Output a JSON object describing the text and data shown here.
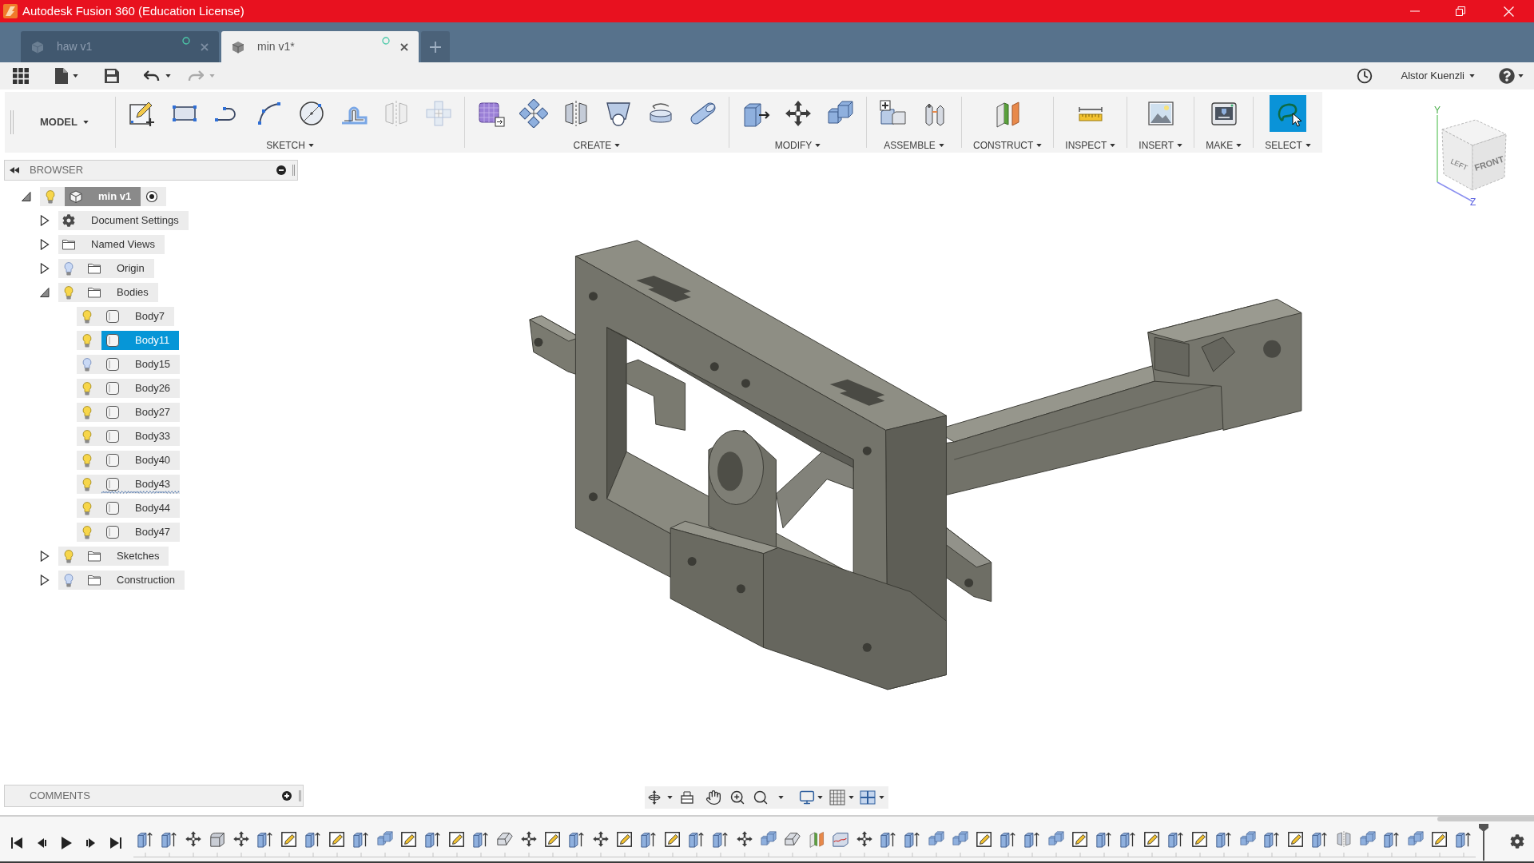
{
  "window": {
    "title": "Autodesk Fusion 360 (Education License)"
  },
  "tabs": [
    {
      "label": "haw v1",
      "selected": false
    },
    {
      "label": "min v1*",
      "selected": true
    }
  ],
  "quick_access": {
    "undo": {
      "disabled": false
    },
    "redo": {
      "disabled": true
    },
    "user": "Alstor Kuenzli"
  },
  "toolbar": {
    "workspace": "MODEL",
    "groups": [
      {
        "label": "SKETCH",
        "tools": [
          {
            "kind": "sketch",
            "selected": false,
            "disabled": false
          },
          {
            "kind": "rectangle",
            "selected": false,
            "disabled": false
          },
          {
            "kind": "line",
            "selected": false,
            "disabled": false
          },
          {
            "kind": "arc",
            "selected": false,
            "disabled": false
          },
          {
            "kind": "circle",
            "selected": false,
            "disabled": false
          },
          {
            "kind": "offset",
            "selected": false,
            "disabled": false
          },
          {
            "kind": "sketchmirror",
            "selected": false,
            "disabled": true
          },
          {
            "kind": "sketchpattern",
            "selected": false,
            "disabled": true
          }
        ]
      },
      {
        "label": "CREATE",
        "tools": [
          {
            "kind": "form",
            "selected": false,
            "disabled": false
          },
          {
            "kind": "pattern",
            "selected": false,
            "disabled": false
          },
          {
            "kind": "mirror",
            "selected": false,
            "disabled": false
          },
          {
            "kind": "hole",
            "selected": false,
            "disabled": false
          },
          {
            "kind": "revolve",
            "selected": false,
            "disabled": false
          },
          {
            "kind": "pipe",
            "selected": false,
            "disabled": false
          }
        ]
      },
      {
        "label": "MODIFY",
        "tools": [
          {
            "kind": "presspull",
            "selected": false,
            "disabled": false
          },
          {
            "kind": "move",
            "selected": false,
            "disabled": false
          },
          {
            "kind": "combine",
            "selected": false,
            "disabled": false
          }
        ]
      },
      {
        "label": "ASSEMBLE",
        "tools": [
          {
            "kind": "newcomponent",
            "selected": false,
            "disabled": false
          },
          {
            "kind": "joint",
            "selected": false,
            "disabled": false
          }
        ]
      },
      {
        "label": "CONSTRUCT",
        "tools": [
          {
            "kind": "plane",
            "selected": false,
            "disabled": false
          }
        ]
      },
      {
        "label": "INSPECT",
        "tools": [
          {
            "kind": "measure",
            "selected": false,
            "disabled": false
          }
        ]
      },
      {
        "label": "INSERT",
        "tools": [
          {
            "kind": "image",
            "selected": false,
            "disabled": false
          }
        ]
      },
      {
        "label": "MAKE",
        "tools": [
          {
            "kind": "print",
            "selected": false,
            "disabled": false
          }
        ]
      },
      {
        "label": "SELECT",
        "tools": [
          {
            "kind": "select",
            "selected": true,
            "disabled": false
          }
        ]
      }
    ]
  },
  "browser": {
    "title": "BROWSER",
    "tree": [
      {
        "label": "min v1",
        "kind": "component",
        "visible": true,
        "active": true,
        "expanded": true,
        "selected": false,
        "children": [
          {
            "label": "Document Settings",
            "kind": "settings",
            "expanded": false,
            "selected": false
          },
          {
            "label": "Named Views",
            "kind": "folder",
            "expanded": false,
            "selected": false
          },
          {
            "label": "Origin",
            "kind": "folder",
            "visible": false,
            "expanded": false,
            "selected": false
          },
          {
            "label": "Bodies",
            "kind": "folder",
            "visible": true,
            "expanded": true,
            "selected": false,
            "children": [
              {
                "label": "Body7",
                "kind": "body",
                "visible": true,
                "selected": false,
                "wavy_underline": false
              },
              {
                "label": "Body11",
                "kind": "body",
                "visible": true,
                "selected": true,
                "wavy_underline": false
              },
              {
                "label": "Body15",
                "kind": "body",
                "visible": false,
                "selected": false,
                "wavy_underline": false
              },
              {
                "label": "Body26",
                "kind": "body",
                "visible": true,
                "selected": false,
                "wavy_underline": false
              },
              {
                "label": "Body27",
                "kind": "body",
                "visible": true,
                "selected": false,
                "wavy_underline": false
              },
              {
                "label": "Body33",
                "kind": "body",
                "visible": true,
                "selected": false,
                "wavy_underline": false
              },
              {
                "label": "Body40",
                "kind": "body",
                "visible": true,
                "selected": false,
                "wavy_underline": false
              },
              {
                "label": "Body43",
                "kind": "body",
                "visible": true,
                "selected": false,
                "wavy_underline": true
              },
              {
                "label": "Body44",
                "kind": "body",
                "visible": true,
                "selected": false,
                "wavy_underline": false
              },
              {
                "label": "Body47",
                "kind": "body",
                "visible": true,
                "selected": false,
                "wavy_underline": false
              }
            ]
          },
          {
            "label": "Sketches",
            "kind": "folder",
            "visible": true,
            "expanded": false,
            "selected": false
          },
          {
            "label": "Construction",
            "kind": "folder",
            "visible": false,
            "expanded": false,
            "selected": false
          }
        ]
      }
    ]
  },
  "viewcube": {
    "left": "LEFT",
    "front": "FRONT",
    "axis_y": "Y",
    "axis_z": "Z"
  },
  "comments": {
    "title": "COMMENTS"
  },
  "timeline": {
    "features": [
      {
        "kind": "extrude"
      },
      {
        "kind": "extrude"
      },
      {
        "kind": "move"
      },
      {
        "kind": "fillet"
      },
      {
        "kind": "move"
      },
      {
        "kind": "extrude"
      },
      {
        "kind": "sketch"
      },
      {
        "kind": "extrude"
      },
      {
        "kind": "sketch"
      },
      {
        "kind": "extrude"
      },
      {
        "kind": "combine"
      },
      {
        "kind": "sketch"
      },
      {
        "kind": "extrude"
      },
      {
        "kind": "sketch"
      },
      {
        "kind": "extrude"
      },
      {
        "kind": "chamfer"
      },
      {
        "kind": "move"
      },
      {
        "kind": "sketch"
      },
      {
        "kind": "extrude"
      },
      {
        "kind": "move"
      },
      {
        "kind": "sketch"
      },
      {
        "kind": "extrude"
      },
      {
        "kind": "sketch"
      },
      {
        "kind": "extrude"
      },
      {
        "kind": "extrude"
      },
      {
        "kind": "move"
      },
      {
        "kind": "combine"
      },
      {
        "kind": "chamfer"
      },
      {
        "kind": "plane"
      },
      {
        "kind": "split"
      },
      {
        "kind": "move"
      },
      {
        "kind": "extrude"
      },
      {
        "kind": "extrude"
      },
      {
        "kind": "combine"
      },
      {
        "kind": "combine"
      },
      {
        "kind": "sketch"
      },
      {
        "kind": "extrude"
      },
      {
        "kind": "extrude"
      },
      {
        "kind": "combine"
      },
      {
        "kind": "sketch"
      },
      {
        "kind": "extrude"
      },
      {
        "kind": "extrude"
      },
      {
        "kind": "sketch"
      },
      {
        "kind": "extrude"
      },
      {
        "kind": "sketch"
      },
      {
        "kind": "extrude"
      },
      {
        "kind": "combine"
      },
      {
        "kind": "extrude"
      },
      {
        "kind": "sketch"
      },
      {
        "kind": "extrude"
      },
      {
        "kind": "mirror"
      },
      {
        "kind": "combine"
      },
      {
        "kind": "extrude"
      },
      {
        "kind": "combine"
      },
      {
        "kind": "sketch"
      },
      {
        "kind": "extrude"
      }
    ]
  }
}
